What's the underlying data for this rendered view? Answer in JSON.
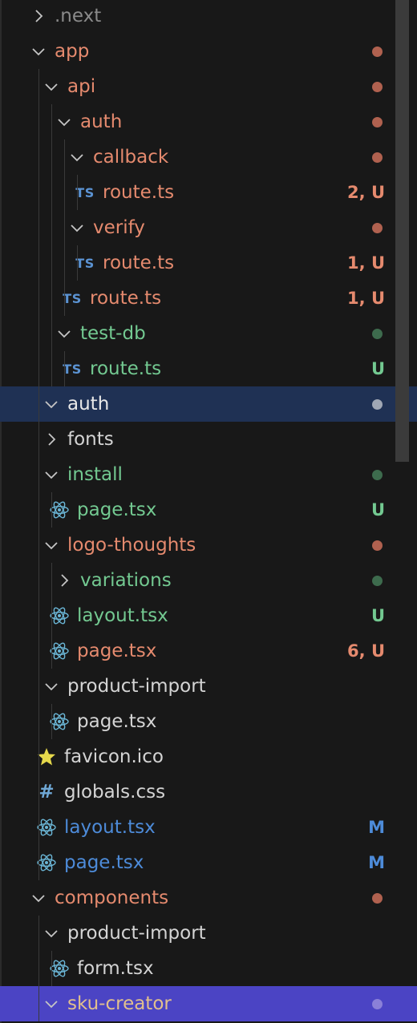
{
  "colors": {
    "error_text": "#e58a6e",
    "error_dot": "#b0614f",
    "untracked_text": "#73c991",
    "untracked_dot": "#3d6b4d",
    "modified_text": "#4d8bd9",
    "selected_bg": "#1f3154",
    "active_bg": "#4b44c4"
  },
  "explorer": {
    "rows": [
      {
        "label": ".next",
        "kind": "folder",
        "open": false,
        "depth": 1,
        "status": "dim"
      },
      {
        "label": "app",
        "kind": "folder",
        "open": true,
        "depth": 1,
        "status": "error",
        "dot": true
      },
      {
        "label": "api",
        "kind": "folder",
        "open": true,
        "depth": 2,
        "status": "error",
        "dot": true
      },
      {
        "label": "auth",
        "kind": "folder",
        "open": true,
        "depth": 3,
        "status": "error",
        "dot": true
      },
      {
        "label": "callback",
        "kind": "folder",
        "open": true,
        "depth": 4,
        "status": "error",
        "dot": true
      },
      {
        "label": "route.ts",
        "kind": "file",
        "icon": "typescript-icon",
        "depth": 5,
        "status": "error",
        "badge": "2, U"
      },
      {
        "label": "verify",
        "kind": "folder",
        "open": true,
        "depth": 4,
        "status": "error",
        "dot": true
      },
      {
        "label": "route.ts",
        "kind": "file",
        "icon": "typescript-icon",
        "depth": 5,
        "status": "error",
        "badge": "1, U"
      },
      {
        "label": "route.ts",
        "kind": "file",
        "icon": "typescript-icon",
        "depth": 4,
        "status": "error",
        "badge": "1, U"
      },
      {
        "label": "test-db",
        "kind": "folder",
        "open": true,
        "depth": 3,
        "status": "new",
        "dot": true
      },
      {
        "label": "route.ts",
        "kind": "file",
        "icon": "typescript-icon",
        "depth": 4,
        "status": "new",
        "badge": "U"
      },
      {
        "label": "auth",
        "kind": "folder",
        "open": true,
        "depth": 2,
        "status": "selected",
        "dot": true,
        "selected": true
      },
      {
        "label": "fonts",
        "kind": "folder",
        "open": false,
        "depth": 2,
        "status": "plain"
      },
      {
        "label": "install",
        "kind": "folder",
        "open": true,
        "depth": 2,
        "status": "new",
        "dot": true
      },
      {
        "label": "page.tsx",
        "kind": "file",
        "icon": "react-icon",
        "depth": 3,
        "status": "new",
        "badge": "U"
      },
      {
        "label": "logo-thoughts",
        "kind": "folder",
        "open": true,
        "depth": 2,
        "status": "error",
        "dot": true
      },
      {
        "label": "variations",
        "kind": "folder",
        "open": false,
        "depth": 3,
        "status": "new",
        "dot": true
      },
      {
        "label": "layout.tsx",
        "kind": "file",
        "icon": "react-icon",
        "depth": 3,
        "status": "new",
        "badge": "U"
      },
      {
        "label": "page.tsx",
        "kind": "file",
        "icon": "react-icon",
        "depth": 3,
        "status": "error",
        "badge": "6, U"
      },
      {
        "label": "product-import",
        "kind": "folder",
        "open": true,
        "depth": 2,
        "status": "plain"
      },
      {
        "label": "page.tsx",
        "kind": "file",
        "icon": "react-icon",
        "depth": 3,
        "status": "plain"
      },
      {
        "label": "favicon.ico",
        "kind": "file",
        "icon": "star-icon",
        "depth": 2,
        "status": "plain"
      },
      {
        "label": "globals.css",
        "kind": "file",
        "icon": "hash-icon",
        "depth": 2,
        "status": "plain"
      },
      {
        "label": "layout.tsx",
        "kind": "file",
        "icon": "react-icon",
        "depth": 2,
        "status": "modified",
        "badge": "M"
      },
      {
        "label": "page.tsx",
        "kind": "file",
        "icon": "react-icon",
        "depth": 2,
        "status": "modified",
        "badge": "M"
      },
      {
        "label": "components",
        "kind": "folder",
        "open": true,
        "depth": 1,
        "status": "error",
        "dot": true
      },
      {
        "label": "product-import",
        "kind": "folder",
        "open": true,
        "depth": 2,
        "status": "plain"
      },
      {
        "label": "form.tsx",
        "kind": "file",
        "icon": "react-icon",
        "depth": 3,
        "status": "plain"
      },
      {
        "label": "sku-creator",
        "kind": "folder",
        "open": true,
        "depth": 2,
        "status": "gold",
        "dot": true,
        "active": true
      }
    ]
  }
}
